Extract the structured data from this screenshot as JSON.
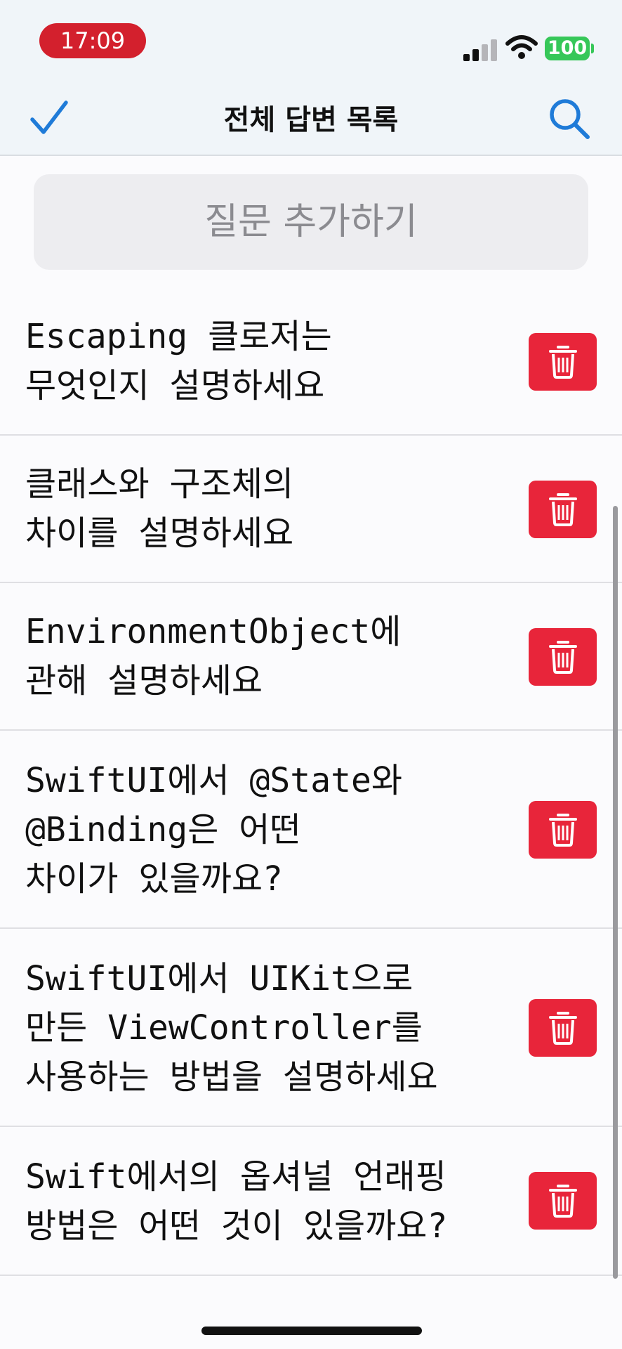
{
  "status_bar": {
    "time": "17:09",
    "battery": "100",
    "time_pill_color": "#d3202d",
    "battery_color": "#36c759",
    "icons": [
      "cellular-signal-icon",
      "wifi-icon",
      "battery-icon"
    ]
  },
  "nav": {
    "title": "전체 답변 목록",
    "left_icon": "checkmark-icon",
    "right_icon": "search-icon",
    "accent_color": "#1f7bd8"
  },
  "add_button": {
    "label": "질문 추가하기"
  },
  "questions": [
    {
      "text": "Escaping 클로저는\n무엇인지 설명하세요"
    },
    {
      "text": "클래스와 구조체의\n차이를 설명하세요"
    },
    {
      "text": "EnvironmentObject에\n관해 설명하세요"
    },
    {
      "text": "SwiftUI에서 @State와\n@Binding은 어떤\n차이가 있을까요?"
    },
    {
      "text": "SwiftUI에서 UIKit으로\n만든 ViewController를\n사용하는 방법을 설명하세요"
    },
    {
      "text": "Swift에서의 옵셔널 언래핑\n방법은 어떤 것이 있을까요?"
    }
  ],
  "delete_icon": "trash-icon",
  "delete_color": "#e8253a"
}
